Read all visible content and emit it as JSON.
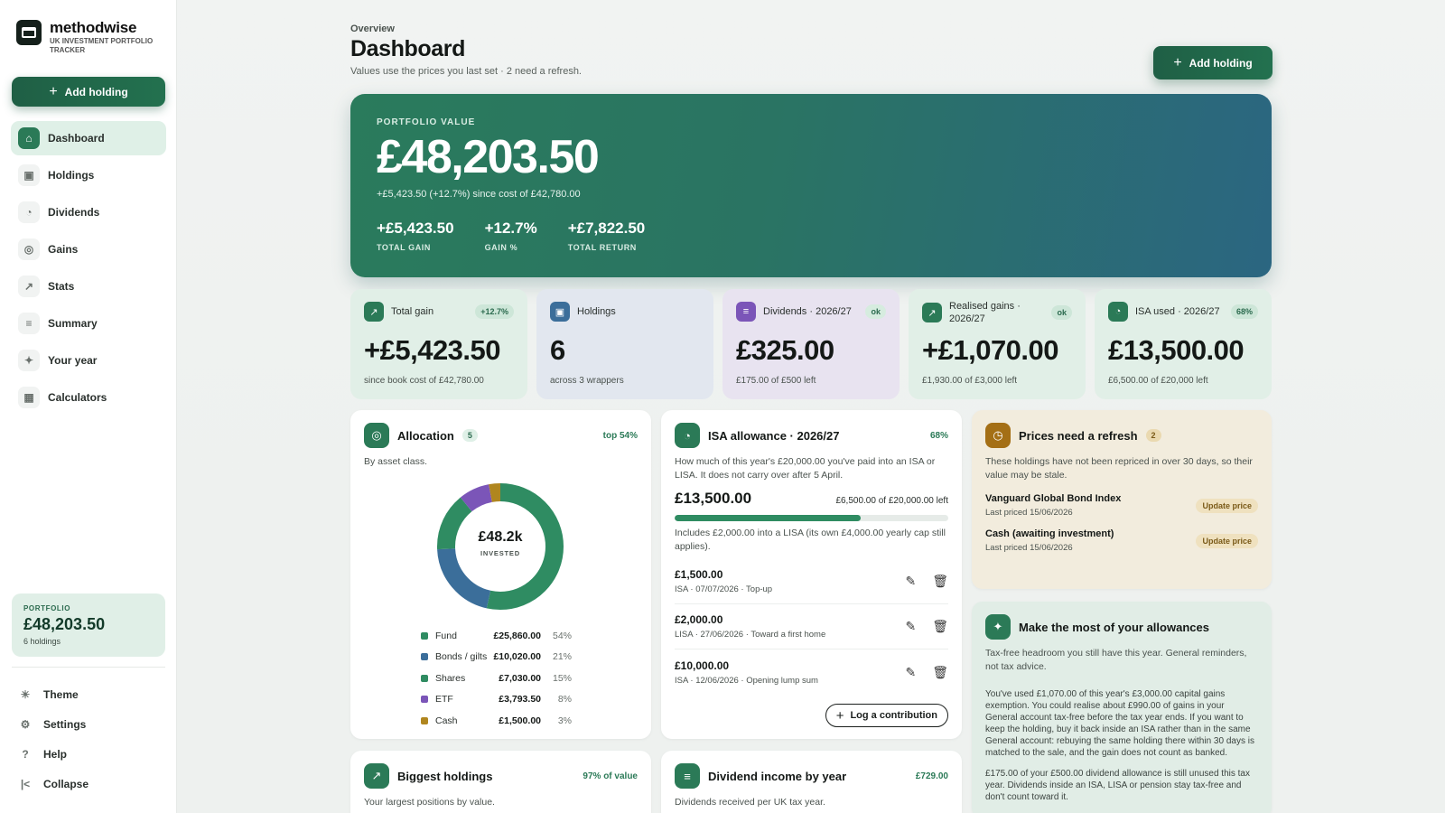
{
  "brand": {
    "name": "methodwise",
    "subtitle": "UK INVESTMENT PORTFOLIO TRACKER"
  },
  "sidebar": {
    "add_label": "Add holding",
    "items": [
      {
        "label": "Dashboard",
        "icon": "home-icon",
        "active": true
      },
      {
        "label": "Holdings",
        "icon": "wallet-icon"
      },
      {
        "label": "Dividends",
        "icon": "coins-icon"
      },
      {
        "label": "Gains",
        "icon": "target-icon"
      },
      {
        "label": "Stats",
        "icon": "trend-icon"
      },
      {
        "label": "Summary",
        "icon": "document-icon"
      },
      {
        "label": "Your year",
        "icon": "sparkle-icon"
      },
      {
        "label": "Calculators",
        "icon": "calculator-icon"
      }
    ],
    "portfolio": {
      "label": "PORTFOLIO",
      "value": "£48,203.50",
      "sub": "6 holdings"
    },
    "footer": [
      {
        "label": "Theme",
        "icon": "sun-icon"
      },
      {
        "label": "Settings",
        "icon": "gear-icon"
      },
      {
        "label": "Help",
        "icon": "help-icon"
      },
      {
        "label": "Collapse",
        "icon": "collapse-icon"
      }
    ]
  },
  "header": {
    "crumb": "Overview",
    "title": "Dashboard",
    "subtitle": "Values use the prices you last set · 2 need a refresh.",
    "add_label": "Add holding"
  },
  "hero": {
    "label": "PORTFOLIO VALUE",
    "value": "£48,203.50",
    "sub": "+£5,423.50 (+12.7%) since cost of £42,780.00",
    "stats": [
      {
        "value": "+£5,423.50",
        "label": "TOTAL GAIN"
      },
      {
        "value": "+12.7%",
        "label": "GAIN %"
      },
      {
        "value": "+£7,822.50",
        "label": "TOTAL RETURN"
      }
    ]
  },
  "kpis": [
    {
      "title": "Total gain",
      "badge": "+12.7%",
      "value": "+£5,423.50",
      "sub": "since book cost of £42,780.00"
    },
    {
      "title": "Holdings",
      "badge": "",
      "value": "6",
      "sub": "across 3 wrappers"
    },
    {
      "title": "Dividends · 2026/27",
      "badge": "ok",
      "value": "£325.00",
      "sub": "£175.00 of £500 left"
    },
    {
      "title": "Realised gains · 2026/27",
      "badge": "ok",
      "value": "+£1,070.00",
      "sub": "£1,930.00 of £3,000 left"
    },
    {
      "title": "ISA used · 2026/27",
      "badge": "68%",
      "value": "£13,500.00",
      "sub": "£6,500.00 of £20,000 left"
    }
  ],
  "allocation": {
    "title": "Allocation",
    "count": "5",
    "right": "top 54%",
    "desc": "By asset class.",
    "center_value": "£48.2k",
    "center_label": "INVESTED",
    "rows": [
      {
        "name": "Fund",
        "value": "£25,860.00",
        "pct": "54%",
        "share": 54,
        "color": "#2f8c62"
      },
      {
        "name": "Bonds / gilts",
        "value": "£10,020.00",
        "pct": "21%",
        "share": 21,
        "color": "#3b6e9a"
      },
      {
        "name": "Shares",
        "value": "£7,030.00",
        "pct": "15%",
        "share": 15,
        "color": "#2f8c62"
      },
      {
        "name": "ETF",
        "value": "£3,793.50",
        "pct": "8%",
        "share": 8,
        "color": "#7b55b8"
      },
      {
        "name": "Cash",
        "value": "£1,500.00",
        "pct": "3%",
        "share": 3,
        "color": "#b0861f"
      }
    ]
  },
  "isa": {
    "title": "ISA allowance · 2026/27",
    "right": "68%",
    "desc": "How much of this year's £20,000.00 you've paid into an ISA or LISA. It does not carry over after 5 April.",
    "amount": "£13,500.00",
    "left": "£6,500.00 of £20,000.00 left",
    "progress": 0.68,
    "note": "Includes £2,000.00 into a LISA (its own £4,000.00 yearly cap still applies).",
    "contributions": [
      {
        "amount": "£1,500.00",
        "meta": "ISA · 07/07/2026 · Top-up"
      },
      {
        "amount": "£2,000.00",
        "meta": "LISA · 27/06/2026 · Toward a first home"
      },
      {
        "amount": "£10,000.00",
        "meta": "ISA · 12/06/2026 · Opening lump sum"
      }
    ],
    "log_label": "Log a contribution"
  },
  "refresh": {
    "title": "Prices need a refresh",
    "count": "2",
    "desc": "These holdings have not been repriced in over 30 days, so their value may be stale.",
    "items": [
      {
        "name": "Vanguard Global Bond Index",
        "date": "Last priced 15/06/2026",
        "action": "Update price"
      },
      {
        "name": "Cash (awaiting investment)",
        "date": "Last priced 15/06/2026",
        "action": "Update price"
      }
    ]
  },
  "allowances": {
    "title": "Make the most of your allowances",
    "desc": "Tax-free headroom you still have this year. General reminders, not tax advice.",
    "tips": [
      "You've used £1,070.00 of this year's £3,000.00 capital gains exemption. You could realise about £990.00 of gains in your General account tax-free before the tax year ends. If you want to keep the holding, buy it back inside an ISA rather than in the same General account: rebuying the same holding there within 30 days is matched to the sale, and the gain does not count as banked.",
      "£175.00 of your £500.00 dividend allowance is still unused this tax year. Dividends inside an ISA, LISA or pension stay tax-free and don't count toward it."
    ]
  },
  "biggest": {
    "title": "Biggest holdings",
    "right": "97% of value",
    "desc": "Your largest positions by value."
  },
  "dividend_income": {
    "title": "Dividend income by year",
    "right": "£729.00",
    "desc": "Dividends received per UK tax year."
  }
}
